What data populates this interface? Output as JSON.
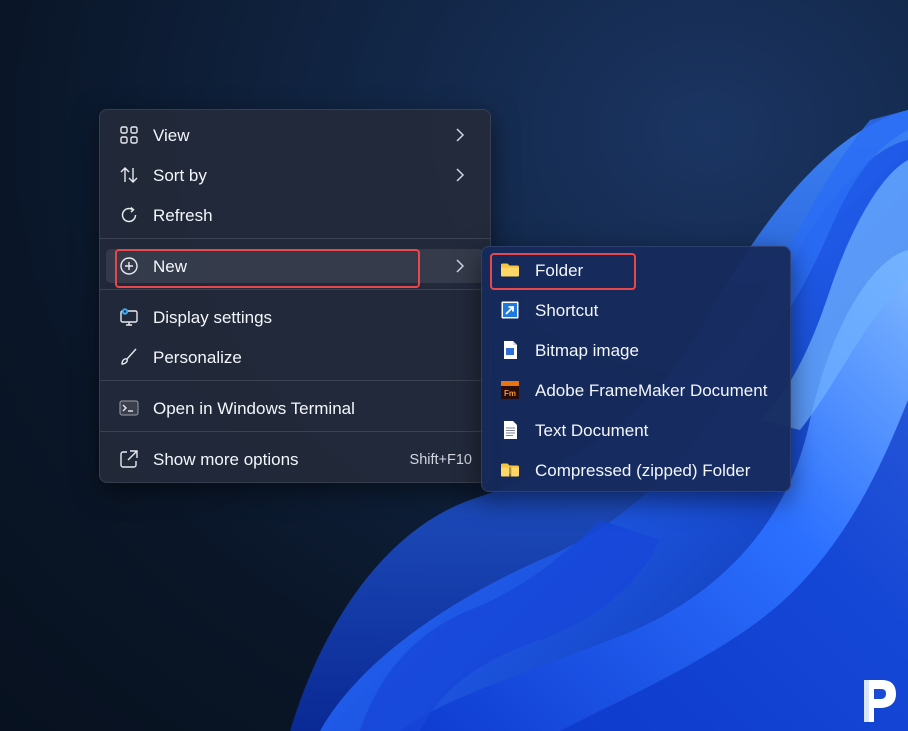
{
  "context_menu": {
    "items": [
      {
        "label": "View",
        "icon": "grid-icon",
        "has_submenu": true
      },
      {
        "label": "Sort by",
        "icon": "sort-arrows-icon",
        "has_submenu": true
      },
      {
        "label": "Refresh",
        "icon": "refresh-icon",
        "has_submenu": false
      },
      {
        "label": "New",
        "icon": "plus-circle-icon",
        "has_submenu": true,
        "highlighted": true
      },
      {
        "label": "Display settings",
        "icon": "display-settings-icon",
        "has_submenu": false
      },
      {
        "label": "Personalize",
        "icon": "brush-icon",
        "has_submenu": false
      },
      {
        "label": "Open in Windows Terminal",
        "icon": "terminal-icon",
        "has_submenu": false
      },
      {
        "label": "Show more options",
        "icon": "expand-icon",
        "has_submenu": false,
        "shortcut": "Shift+F10"
      }
    ]
  },
  "new_submenu": {
    "items": [
      {
        "label": "Folder",
        "icon": "folder-icon",
        "highlighted": true
      },
      {
        "label": "Shortcut",
        "icon": "shortcut-arrow-icon"
      },
      {
        "label": "Bitmap image",
        "icon": "bitmap-file-icon"
      },
      {
        "label": "Adobe FrameMaker Document",
        "icon": "framemaker-icon",
        "icon_text": "Fm"
      },
      {
        "label": "Text Document",
        "icon": "text-file-icon"
      },
      {
        "label": "Compressed (zipped) Folder",
        "icon": "zip-folder-icon"
      }
    ]
  },
  "colors": {
    "highlight_border": "#e8484c",
    "wallpaper_blue": "#1f5ae8",
    "menu_background": "#242a3a",
    "submenu_background": "#162a5c"
  }
}
